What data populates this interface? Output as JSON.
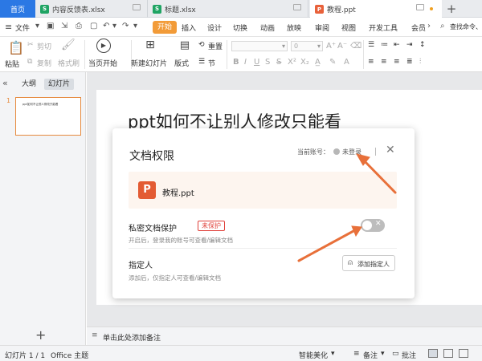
{
  "tabs": {
    "home": "首页",
    "doc1": "内容反馈表.xlsx",
    "doc2": "标题.xlsx",
    "doc3": "教程.ppt",
    "xls_glyph": "S",
    "ppt_glyph": "P"
  },
  "menu": {
    "file": "文件",
    "start": "开始",
    "items": [
      "插入",
      "设计",
      "切换",
      "动画",
      "放映",
      "审阅",
      "视图",
      "开发工具",
      "会员"
    ],
    "search": "查找命令、"
  },
  "ribbon": {
    "paste": "粘贴",
    "cut": "剪切",
    "copy": "复制",
    "format_painter": "格式刷",
    "play_from_current": "当页开始",
    "new_slide": "新建幻灯片",
    "layout": "版式",
    "reset": "重置",
    "section": "节",
    "font_size": "0"
  },
  "left_panel": {
    "outline": "大纲",
    "slides": "幻灯片",
    "thumb_number": "1",
    "thumb_text": "ppt如何不让别人修改只能看"
  },
  "slide": {
    "title": "ppt如何不让别人修改只能看"
  },
  "dialog": {
    "title": "文档权限",
    "account_label": "当前账号：",
    "account_value": "未登录",
    "file_name": "教程.ppt",
    "private_title": "私密文档保护",
    "private_badge": "未保护",
    "private_desc": "开启后，登录我的账号可查看/编辑文档",
    "designate_title": "指定人",
    "designate_desc": "添加后，仅指定人可查看/编辑文档",
    "add_button": "添加指定人",
    "toggle_state": "off"
  },
  "notes": {
    "placeholder": "单击此处添加备注"
  },
  "status": {
    "slide_counter": "幻灯片 1 / 1",
    "theme": "Office 主题",
    "beautify": "智能美化",
    "notes": "备注",
    "comments": "批注"
  },
  "colors": {
    "accent_blue": "#2b78e4",
    "start_orange": "#f29b38",
    "ppt_red": "#e35b33",
    "arrow": "#e8703a",
    "badge_red": "#e0403a"
  }
}
